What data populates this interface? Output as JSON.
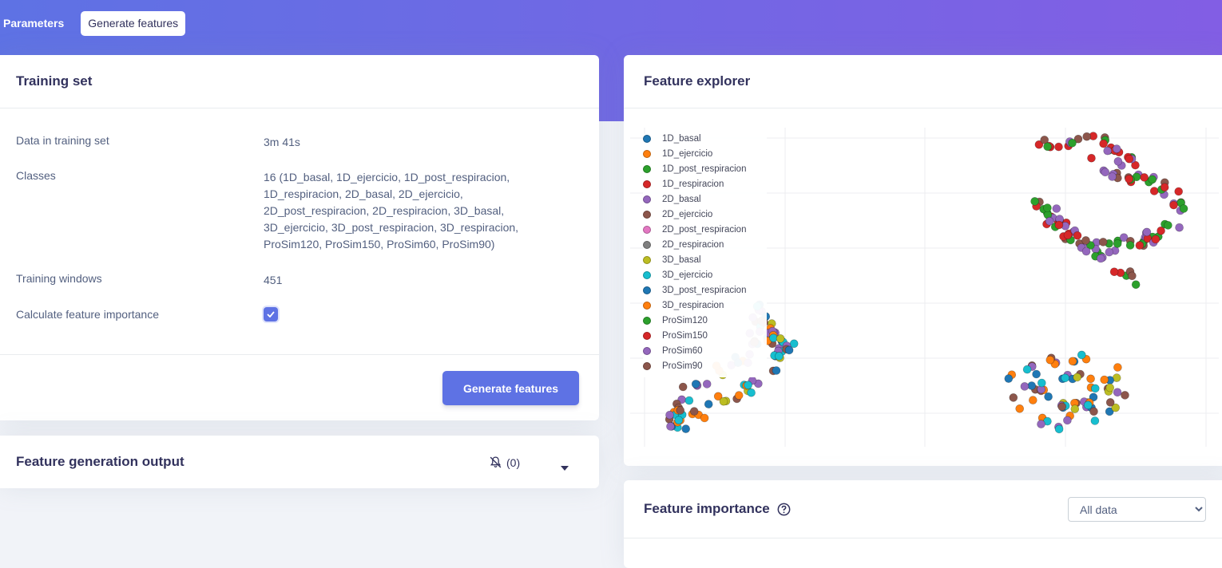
{
  "nav": {
    "tabs": [
      "Parameters",
      "Generate features"
    ]
  },
  "training_set": {
    "title": "Training set",
    "rows": [
      {
        "label": "Data in training set",
        "value": "3m 41s"
      },
      {
        "label": "Classes",
        "value": "16 (1D_basal, 1D_ejercicio, 1D_post_respiracion, 1D_respiracion, 2D_basal, 2D_ejercicio, 2D_post_respiracion, 2D_respiracion, 3D_basal, 3D_ejercicio, 3D_post_respiracion, 3D_respiracion, ProSim120, ProSim150, ProSim60, ProSim90)"
      },
      {
        "label": "Training windows",
        "value": "451"
      },
      {
        "label": "Calculate feature importance",
        "checked": true
      }
    ],
    "button": "Generate features"
  },
  "output": {
    "title": "Feature generation output",
    "count": "(0)",
    "icons": [
      "bell-slash-icon",
      "caret-down-icon"
    ]
  },
  "explorer": {
    "title": "Feature explorer",
    "legend": [
      {
        "name": "1D_basal",
        "color": "#1f77b4"
      },
      {
        "name": "1D_ejercicio",
        "color": "#ff7f0e"
      },
      {
        "name": "1D_post_respiracion",
        "color": "#2ca02c"
      },
      {
        "name": "1D_respiracion",
        "color": "#d62728"
      },
      {
        "name": "2D_basal",
        "color": "#9467bd"
      },
      {
        "name": "2D_ejercicio",
        "color": "#8c564b"
      },
      {
        "name": "2D_post_respiracion",
        "color": "#e377c2"
      },
      {
        "name": "2D_respiracion",
        "color": "#7f7f7f"
      },
      {
        "name": "3D_basal",
        "color": "#bcbd22"
      },
      {
        "name": "3D_ejercicio",
        "color": "#17becf"
      },
      {
        "name": "3D_post_respiracion",
        "color": "#1f77b4"
      },
      {
        "name": "3D_respiracion",
        "color": "#ff7f0e"
      },
      {
        "name": "ProSim120",
        "color": "#2ca02c"
      },
      {
        "name": "ProSim150",
        "color": "#d62728"
      },
      {
        "name": "ProSim60",
        "color": "#9467bd"
      },
      {
        "name": "ProSim90",
        "color": "#8c564b"
      }
    ]
  },
  "importance": {
    "title": "Feature importance",
    "select_value": "All data",
    "select_options": [
      "All data"
    ]
  },
  "chart_data": {
    "type": "scatter",
    "grid": true,
    "legend_position": "top-left",
    "clusters": [
      {
        "name": "upper-right",
        "center": [
          0.7,
          0.26
        ],
        "classes": [
          "1D_respiracion",
          "ProSim120",
          "ProSim90",
          "1D_post_respiracion",
          "ProSim150",
          "2D_basal",
          "ProSim60"
        ]
      },
      {
        "name": "lower-left",
        "center": [
          0.05,
          0.8
        ],
        "classes": [
          "3D_ejercicio",
          "3D_respiracion",
          "2D_basal",
          "3D_basal",
          "1D_basal",
          "ProSim60",
          "ProSim90"
        ]
      },
      {
        "name": "lower-right",
        "center": [
          0.62,
          0.82
        ],
        "classes": [
          "3D_respiracion",
          "2D_basal",
          "3D_basal",
          "1D_ejercicio",
          "3D_ejercicio",
          "1D_basal",
          "2D_ejercicio"
        ]
      }
    ]
  }
}
